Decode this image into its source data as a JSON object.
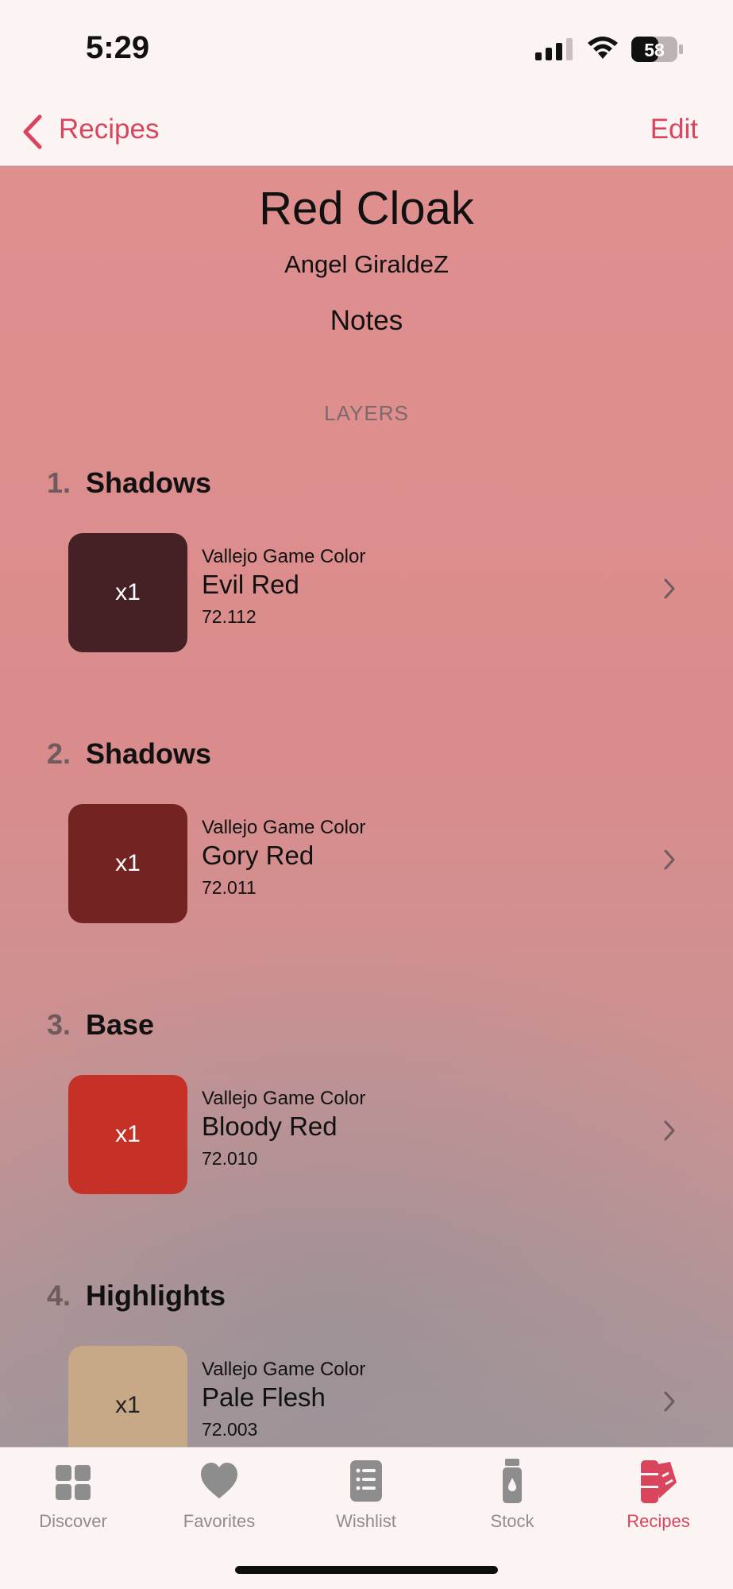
{
  "status_bar": {
    "time": "5:29",
    "battery": "58",
    "icons": [
      "signal-icon",
      "wifi-icon",
      "battery-icon"
    ]
  },
  "nav": {
    "back_label": "Recipes",
    "edit_label": "Edit",
    "accent_color": "#d8455d"
  },
  "recipe": {
    "title": "Red Cloak",
    "author": "Angel GiraldeZ",
    "notes_label": "Notes",
    "section_label": "LAYERS"
  },
  "layers": [
    {
      "number": "1.",
      "name": "Shadows",
      "quantity": "x1",
      "brand": "Vallejo Game Color",
      "paint": "Evil Red",
      "code": "72.112",
      "color": "#452125",
      "text_color": "#ffffff"
    },
    {
      "number": "2.",
      "name": "Shadows",
      "quantity": "x1",
      "brand": "Vallejo Game Color",
      "paint": "Gory Red",
      "code": "72.011",
      "color": "#732321",
      "text_color": "#ffffff"
    },
    {
      "number": "3.",
      "name": "Base",
      "quantity": "x1",
      "brand": "Vallejo Game Color",
      "paint": "Bloody Red",
      "code": "72.010",
      "color": "#c63127",
      "text_color": "#ffffff"
    },
    {
      "number": "4.",
      "name": "Highlights",
      "quantity": "x1",
      "brand": "Vallejo Game Color",
      "paint": "Pale Flesh",
      "code": "72.003",
      "color": "#c7a987",
      "text_color": "#222222"
    }
  ],
  "tabs": [
    {
      "label": "Discover",
      "icon": "grid-icon",
      "active": false
    },
    {
      "label": "Favorites",
      "icon": "heart-icon",
      "active": false
    },
    {
      "label": "Wishlist",
      "icon": "list-icon",
      "active": false
    },
    {
      "label": "Stock",
      "icon": "paint-bottle-icon",
      "active": false
    },
    {
      "label": "Recipes",
      "icon": "swatches-icon",
      "active": true
    }
  ]
}
